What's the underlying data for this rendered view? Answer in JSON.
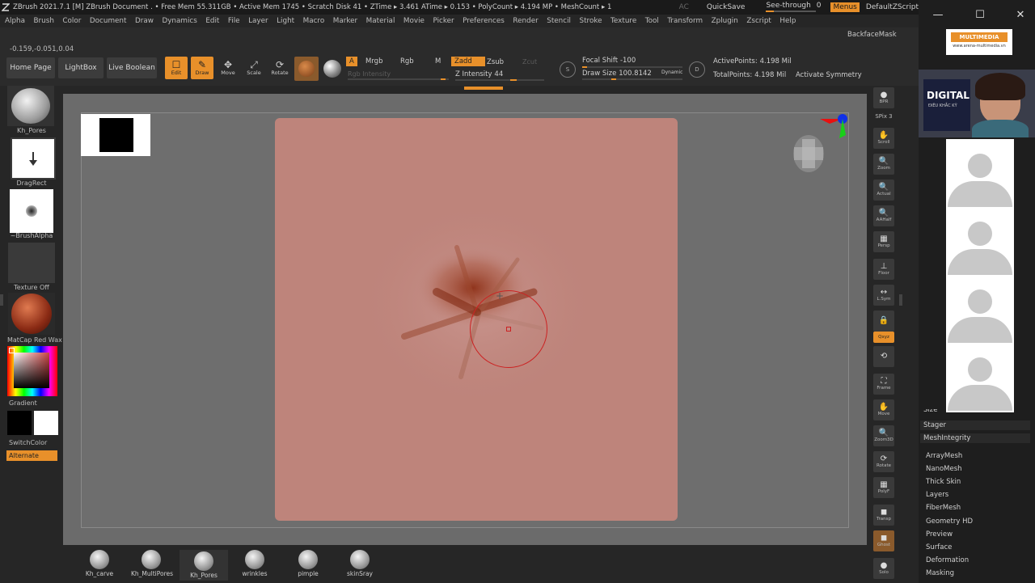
{
  "titlebar": {
    "title": "ZBrush 2021.7.1 [M]   ZBrush Document    . • Free Mem 55.311GB • Active Mem 1745 • Scratch Disk 41 • ZTime ▸ 3.461 ATime ▸ 0.153 • PolyCount ▸ 4.194 MP • MeshCount ▸ 1",
    "ac": "AC",
    "quicksave": "QuickSave",
    "see_through_label": "See-through",
    "see_through_value": "0",
    "see_through_fill": 0.15,
    "menus": "Menus",
    "default_zscript": "DefaultZScript"
  },
  "menubar": [
    "Alpha",
    "Brush",
    "Color",
    "Document",
    "Draw",
    "Dynamics",
    "Edit",
    "File",
    "Layer",
    "Light",
    "Macro",
    "Marker",
    "Material",
    "Movie",
    "Picker",
    "Preferences",
    "Render",
    "Stencil",
    "Stroke",
    "Texture",
    "Tool",
    "Transform",
    "Zplugin",
    "Zscript",
    "Help"
  ],
  "shelf": {
    "coords": "-0.159,-0.051,0.04",
    "backface_mask": "BackfaceMask",
    "home_page": "Home Page",
    "lightbox": "LightBox",
    "live_boolean": "Live Boolean",
    "tools": [
      {
        "label": "Edit",
        "icon": "☐",
        "active": true
      },
      {
        "label": "Draw",
        "icon": "✎",
        "active": true
      },
      {
        "label": "Move",
        "icon": "✥",
        "active": false
      },
      {
        "label": "Scale",
        "icon": "⤢",
        "active": false
      },
      {
        "label": "Rotate",
        "icon": "⟳",
        "active": false
      }
    ],
    "a_label": "A",
    "mrgb": "Mrgb",
    "rgb": "Rgb",
    "m": "M",
    "rgb_intensity": "Rgb Intensity",
    "zadd": "Zadd",
    "zsub": "Zsub",
    "zcut": "Zcut",
    "z_intensity_label": "Z Intensity",
    "z_intensity_value": "44",
    "z_intensity_fill": 0.44,
    "focal_shift_label": "Focal Shift",
    "focal_shift_value": "-100",
    "draw_size_label": "Draw Size",
    "draw_size_value": "100.8142",
    "dynamic": "Dynamic",
    "active_points_label": "ActivePoints:",
    "active_points_value": "4.198 Mil",
    "total_points_label": "TotalPoints:",
    "total_points_value": "4.198 Mil",
    "activate_symmetry": "Activate Symmetry"
  },
  "leftpanel": {
    "brush_name": "Kh_Pores",
    "stroke_name": "DragRect",
    "alpha_name": "~BrushAlpha",
    "texture_name": "Texture Off",
    "material_name": "MatCap Red Wax",
    "gradient": "Gradient",
    "switch_color": "SwitchColor",
    "alternate": "Alternate"
  },
  "rightbar": [
    {
      "label": "BPR",
      "icon": "●"
    },
    {
      "label": "SPix 3",
      "icon": ""
    },
    {
      "label": "Scroll",
      "icon": "✋"
    },
    {
      "label": "Zoom",
      "icon": "🔍"
    },
    {
      "label": "Actual",
      "icon": "🔍"
    },
    {
      "label": "AAHalf",
      "icon": "🔍"
    },
    {
      "label": "Persp",
      "icon": "▦"
    },
    {
      "label": "Floor",
      "icon": "⊥"
    },
    {
      "label": "L.Sym",
      "icon": "↔"
    },
    {
      "label": "",
      "icon": "🔒"
    },
    {
      "label": "Qxyz",
      "icon": ""
    },
    {
      "label": "",
      "icon": "⟲"
    },
    {
      "label": "Frame",
      "icon": "⛶"
    },
    {
      "label": "Move",
      "icon": "✋"
    },
    {
      "label": "Zoom3D",
      "icon": "🔍"
    },
    {
      "label": "Rotate",
      "icon": "⟳"
    },
    {
      "label": "PolyF",
      "icon": "▦"
    },
    {
      "label": "Transp",
      "icon": "◼"
    },
    {
      "label": "Ghost",
      "icon": "◼"
    },
    {
      "label": "Solo",
      "icon": "●"
    }
  ],
  "sidepanel": {
    "logo_text": "MULTIMEDIA",
    "logo_url": "www.arena-multimedia.vn",
    "speaker_text": "DIGITAL",
    "speaker_sub": "ĐIÊU KHẮC KỸ",
    "menu_items_top": [
      "Size",
      "Stager",
      "MeshIntegrity"
    ],
    "menu_items": [
      "ArrayMesh",
      "NanoMesh",
      "Thick Skin",
      "Layers",
      "FiberMesh",
      "Geometry HD",
      "Preview",
      "Surface",
      "Deformation",
      "Masking"
    ]
  },
  "bottom_brushes": [
    "Kh_carve",
    "Kh_MultiPores",
    "Kh_Pores",
    "wrinkles",
    "pimple",
    "skinSray"
  ],
  "colors": {
    "accent": "#e8902a",
    "doc": "#be847b",
    "cursor": "#cc2222"
  }
}
